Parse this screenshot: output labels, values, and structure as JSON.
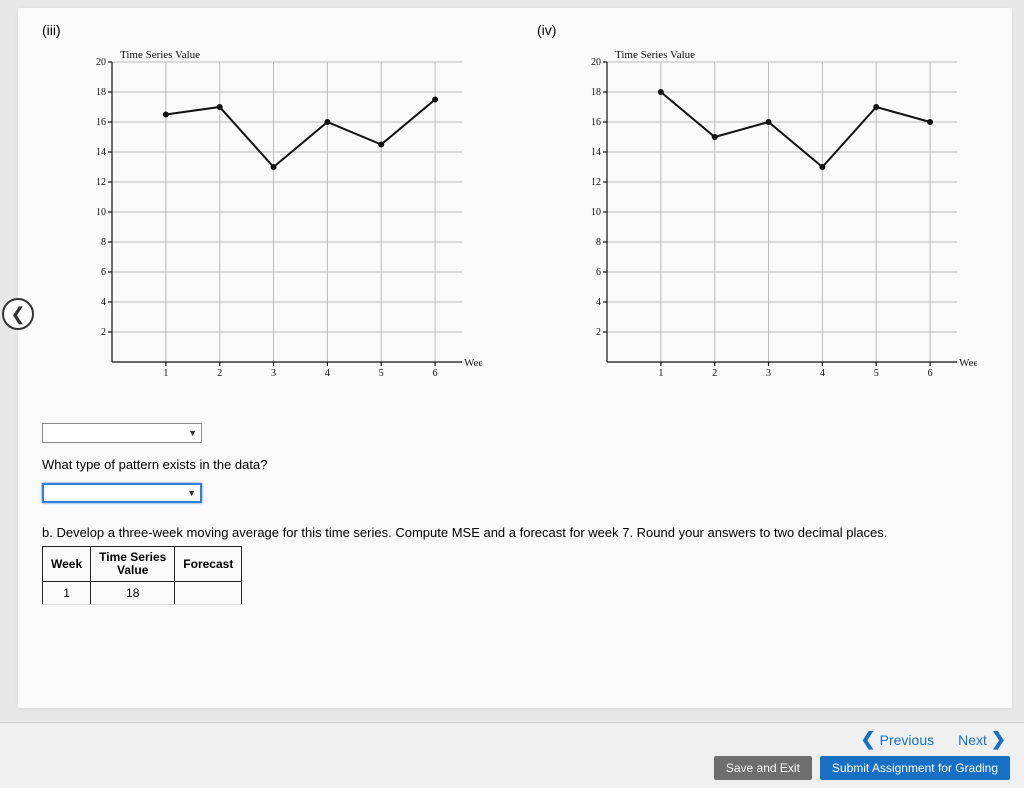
{
  "labels": {
    "chart3": "(iii)",
    "chart4": "(iv)",
    "question": "What type of pattern exists in the data?",
    "section_b": "b.  Develop a three-week moving average for this time series. Compute MSE and a forecast for week 7. Round your answers to two decimal places.",
    "prev": "Previous",
    "next": "Next",
    "save_exit": "Save and Exit",
    "submit": "Submit Assignment for Grading"
  },
  "table": {
    "headers": [
      "Week",
      "Time Series\nValue",
      "Forecast"
    ],
    "row1_week": "1",
    "row1_value": "18"
  },
  "chart_data": [
    {
      "type": "line",
      "title": "Time Series Value",
      "xlabel": "Week(t)",
      "ylabel": "",
      "xlim": [
        0,
        6.5
      ],
      "ylim": [
        0,
        20
      ],
      "xticks": [
        1,
        2,
        3,
        4,
        5,
        6
      ],
      "yticks": [
        2,
        4,
        6,
        8,
        10,
        12,
        14,
        16,
        18,
        20
      ],
      "series": [
        {
          "name": "series-iii",
          "x": [
            1,
            2,
            3,
            4,
            5,
            6
          ],
          "values": [
            16.5,
            17,
            13,
            16,
            14.5,
            17.5
          ]
        }
      ]
    },
    {
      "type": "line",
      "title": "Time Series Value",
      "xlabel": "Week(t)",
      "ylabel": "",
      "xlim": [
        0,
        6.5
      ],
      "ylim": [
        0,
        20
      ],
      "xticks": [
        1,
        2,
        3,
        4,
        5,
        6
      ],
      "yticks": [
        2,
        4,
        6,
        8,
        10,
        12,
        14,
        16,
        18,
        20
      ],
      "series": [
        {
          "name": "series-iv",
          "x": [
            1,
            2,
            3,
            4,
            5,
            6
          ],
          "values": [
            18,
            15,
            16,
            13,
            17,
            16
          ]
        }
      ]
    }
  ]
}
